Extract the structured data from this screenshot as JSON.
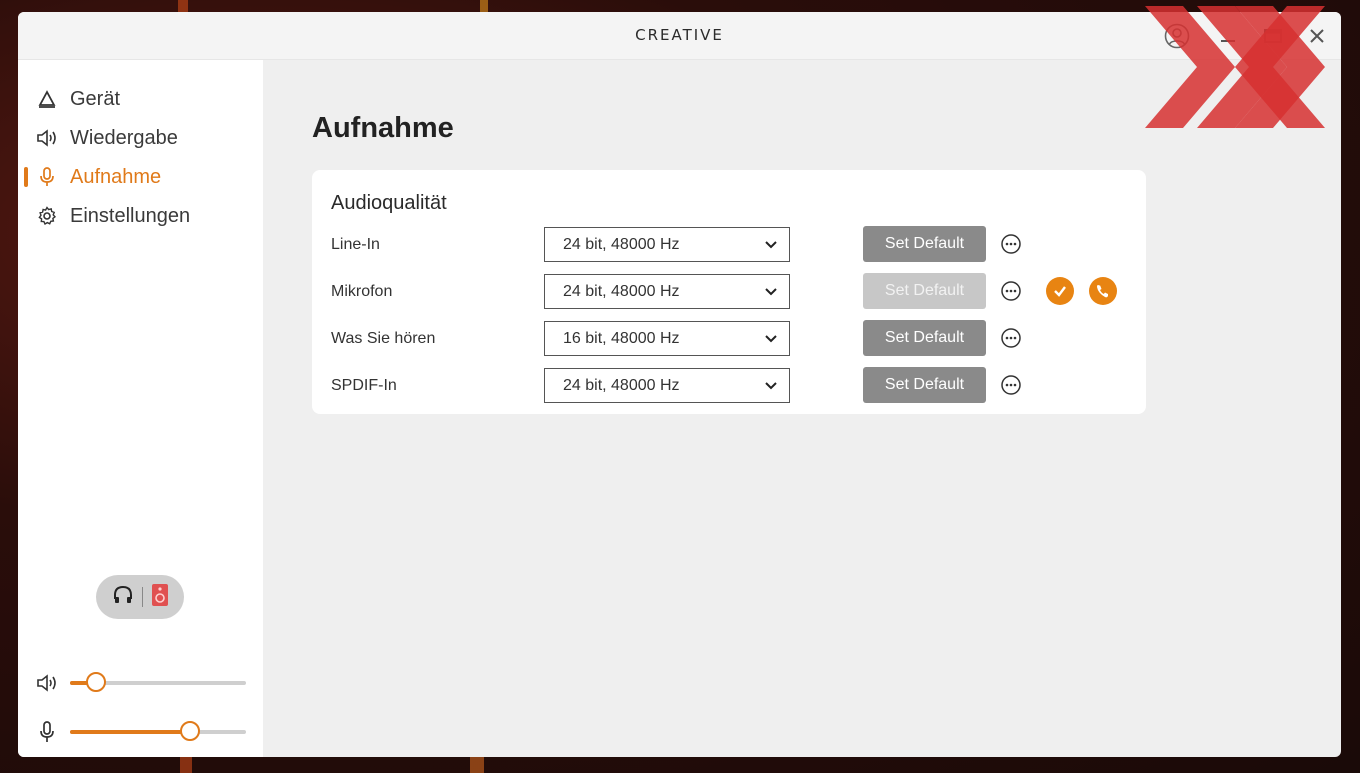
{
  "window": {
    "brand": "CREATIVE"
  },
  "sidebar": {
    "items": [
      {
        "label": "Gerät",
        "icon": "device-icon",
        "active": false
      },
      {
        "label": "Wiedergabe",
        "icon": "speaker-icon",
        "active": false
      },
      {
        "label": "Aufnahme",
        "icon": "microphone-icon",
        "active": true
      },
      {
        "label": "Einstellungen",
        "icon": "gear-icon",
        "active": false
      }
    ],
    "output_toggle": {
      "left_icon": "headphones-icon",
      "right_icon": "speaker-box-icon"
    },
    "volume": {
      "icon": "speaker-icon",
      "level": 0.15
    },
    "mic": {
      "icon": "microphone-icon",
      "level": 0.68
    }
  },
  "main": {
    "title": "Aufnahme",
    "card": {
      "title": "Audioqualität",
      "rows": [
        {
          "label": "Line-In",
          "value": "24 bit, 48000 Hz",
          "button": "Set Default",
          "button_enabled": true
        },
        {
          "label": "Mikrofon",
          "value": "24 bit, 48000 Hz",
          "button": "Set Default",
          "button_enabled": false,
          "is_default": true,
          "is_comm_default": true
        },
        {
          "label": "Was Sie hören",
          "value": "16 bit, 48000 Hz",
          "button": "Set Default",
          "button_enabled": true
        },
        {
          "label": "SPDIF-In",
          "value": "24 bit, 48000 Hz",
          "button": "Set Default",
          "button_enabled": true
        }
      ]
    }
  },
  "colors": {
    "accent": "#e07a1a",
    "button": "#8a8a8a",
    "button_disabled": "#c7c7c7",
    "badge": "#e88412"
  }
}
